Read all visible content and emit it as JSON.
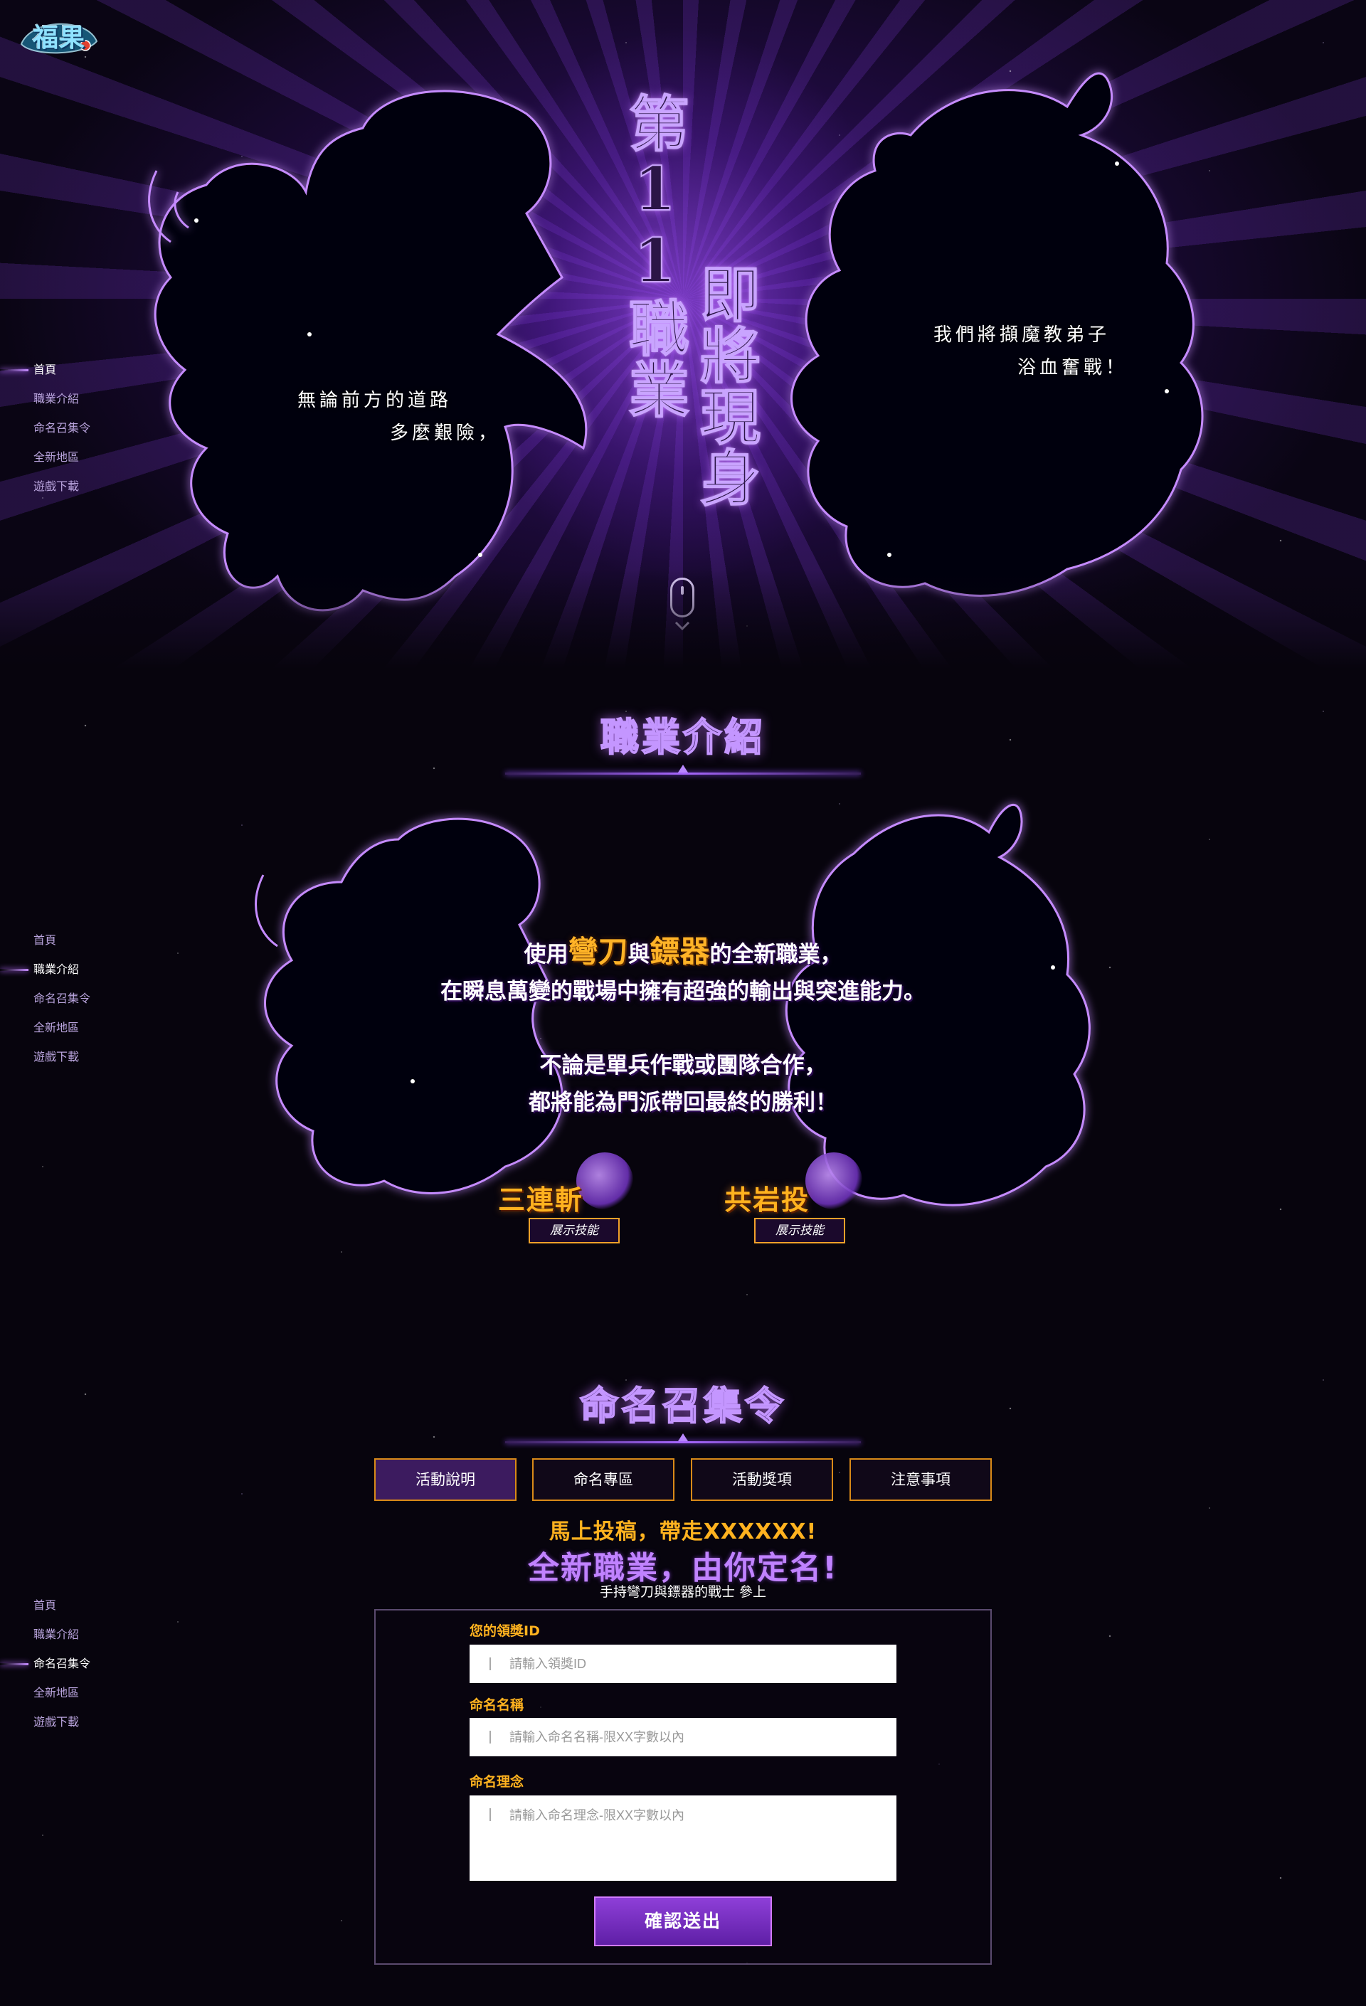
{
  "logo": {
    "text": "福果"
  },
  "nav": {
    "items": [
      {
        "label": "首頁"
      },
      {
        "label": "職業介紹"
      },
      {
        "label": "命名召集令"
      },
      {
        "label": "全新地區"
      },
      {
        "label": "遊戲下載"
      }
    ]
  },
  "hero": {
    "title_col1": "第11職業",
    "title_col2": "即將現身",
    "caption_left_1": "無論前方的道路",
    "caption_left_2": "多麼艱險，",
    "caption_right_1": "我們將擷魔教弟子",
    "caption_right_2": "浴血奮戰！"
  },
  "intro": {
    "title": "職業介紹",
    "line1_pre": "使用",
    "line1_hl1": "彎刀",
    "line1_mid": "與",
    "line1_hl2": "鏢器",
    "line1_post": "的全新職業，",
    "line2": "在瞬息萬變的戰場中擁有超強的輸出與突進能力。",
    "line3": "不論是單兵作戰或團隊合作，",
    "line4": "都將能為門派帶回最終的勝利！",
    "skills": [
      {
        "name": "三連斬",
        "button": "展示技能"
      },
      {
        "name": "共岩投",
        "button": "展示技能"
      }
    ]
  },
  "naming": {
    "title": "命名召集令",
    "tabs": [
      {
        "label": "活動說明"
      },
      {
        "label": "命名專區"
      },
      {
        "label": "活動獎項"
      },
      {
        "label": "注意事項"
      }
    ],
    "promo_line1": "馬上投稿，帶走XXXXXX!",
    "promo_line2": "全新職業，由你定名!",
    "promo_line3": "手持彎刀與鏢器的戰士 參上",
    "form": {
      "id_label": "您的領獎ID",
      "id_placeholder": "請輸入領獎ID",
      "name_label": "命名名稱",
      "name_placeholder": "請輸入命名名稱-限XX字數以內",
      "concept_label": "命名理念",
      "concept_placeholder": "請輸入命名理念-限XX字數以內",
      "submit_label": "確認送出"
    }
  },
  "colors": {
    "accent_purple": "#a767ff",
    "highlight_orange": "#ffb21f",
    "background": "#07040d"
  }
}
